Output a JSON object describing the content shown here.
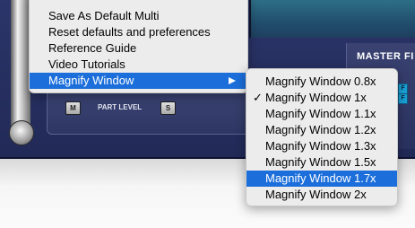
{
  "background": {
    "master_section_label": "MASTER FI",
    "part_level_label": "PART LEVEL",
    "mute_button_label": "M",
    "solo_button_label": "S",
    "fx_badge_label_1": "F",
    "fx_badge_label_2": "F"
  },
  "main_menu": {
    "items": [
      {
        "label": "Save As Default Multi"
      },
      {
        "label": "Reset defaults and preferences"
      },
      {
        "label": "Reference Guide"
      },
      {
        "label": "Video Tutorials"
      },
      {
        "label": "Magnify Window",
        "selected": true,
        "has_submenu": true,
        "submenu_icon": "chevron-right-icon"
      }
    ]
  },
  "magnify_submenu": {
    "checkmark": "✓",
    "items": [
      {
        "label": "Magnify Window 0.8x"
      },
      {
        "label": "Magnify Window 1x",
        "checked": true
      },
      {
        "label": "Magnify Window 1.1x"
      },
      {
        "label": "Magnify Window 1.2x"
      },
      {
        "label": "Magnify Window 1.3x"
      },
      {
        "label": "Magnify Window 1.5x"
      },
      {
        "label": "Magnify Window 1.7x",
        "highlighted": true
      },
      {
        "label": "Magnify Window 2x"
      }
    ]
  },
  "colors": {
    "menu_background": "#ececec",
    "selection_highlight": "#1c6fdb",
    "app_background": "#2b3569"
  }
}
